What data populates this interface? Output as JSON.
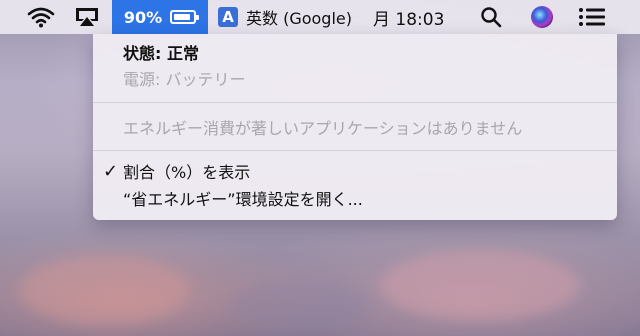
{
  "menubar": {
    "battery_percent": "90%",
    "battery_level": 0.9,
    "input_letter": "A",
    "input_label": "英数 (Google)",
    "clock": "月 18:03",
    "icons": [
      "wifi-icon",
      "airplay-icon",
      "battery-icon",
      "input-source-icon",
      "search-icon",
      "siri-icon",
      "control-strip-icon"
    ]
  },
  "battery_menu": {
    "status": "状態: 正常",
    "power_source": "電源: バッテリー",
    "significant_energy": "エネルギー消費が著しいアプリケーションはありません",
    "show_percentage": "割合（%）を表示",
    "show_percentage_checked": true,
    "check_mark": "✓",
    "open_prefs": "“省エネルギー”環境設定を開く..."
  }
}
